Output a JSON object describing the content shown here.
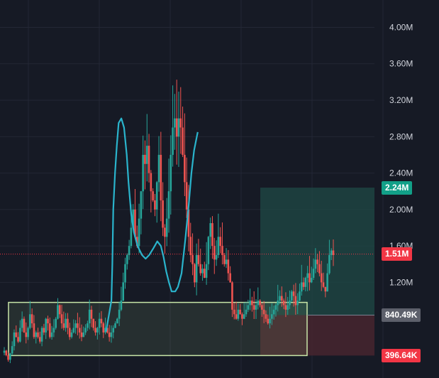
{
  "colors": {
    "background": "#161a25",
    "grid": "#232735",
    "up": "#26a69a",
    "down": "#ef5350",
    "curve": "#2ab4cc",
    "target_zone": "#1f4a46",
    "stop_zone": "#4a2630",
    "accumulation_box": "#c8e6a8",
    "tag_target": "#12a088",
    "tag_current": "#f23645",
    "tag_entry": "#5d606b",
    "tag_stop": "#f23645"
  },
  "price_tags": {
    "target": "2.24M",
    "current": "1.51M",
    "entry": "840.49K",
    "stop": "396.64K"
  },
  "chart_data": {
    "type": "candlestick",
    "y_axis": {
      "ticks": [
        "4.00M",
        "3.60M",
        "3.20M",
        "2.80M",
        "2.40M",
        "2.00M",
        "1.60M",
        "1.20M"
      ],
      "tick_values": [
        4.0,
        3.6,
        3.2,
        2.8,
        2.4,
        2.0,
        1.6,
        1.2
      ],
      "unit": "M",
      "range": [
        0.15,
        4.3
      ]
    },
    "levels": {
      "target": 2.24,
      "current": 1.51,
      "entry": 0.8405,
      "stop": 0.3966,
      "accumulation_top": 0.98
    },
    "close": [
      0.45,
      0.4,
      0.35,
      0.42,
      0.5,
      0.65,
      0.6,
      0.55,
      0.7,
      0.8,
      0.65,
      0.6,
      0.7,
      0.85,
      0.75,
      0.6,
      0.65,
      0.6,
      0.55,
      0.7,
      0.65,
      0.8,
      0.75,
      0.6,
      0.65,
      0.7,
      0.8,
      0.95,
      0.85,
      0.75,
      0.7,
      0.8,
      0.7,
      0.6,
      0.65,
      0.7,
      0.75,
      0.7,
      0.65,
      0.6,
      0.65,
      0.7,
      0.75,
      0.9,
      0.8,
      0.7,
      0.65,
      0.7,
      0.8,
      0.75,
      0.65,
      0.7,
      0.65,
      0.6,
      0.65,
      0.7,
      0.75,
      0.8,
      0.9,
      1.0,
      1.2,
      1.4,
      1.5,
      1.6,
      1.8,
      2.0,
      1.7,
      1.6,
      1.9,
      2.2,
      2.6,
      2.5,
      2.7,
      2.4,
      2.2,
      2.1,
      2.0,
      2.3,
      2.6,
      2.1,
      1.8,
      1.7,
      1.9,
      2.2,
      2.6,
      2.9,
      3.0,
      2.8,
      3.0,
      2.9,
      2.6,
      2.3,
      2.0,
      1.7,
      1.5,
      1.4,
      1.2,
      1.5,
      1.4,
      1.3,
      1.35,
      1.25,
      1.4,
      1.7,
      1.85,
      1.6,
      1.45,
      1.5,
      1.7,
      1.6,
      1.5,
      1.4,
      1.45,
      1.3,
      1.2,
      0.9,
      0.85,
      0.8,
      0.9,
      0.85,
      0.8,
      0.85,
      0.9,
      0.95,
      1.0,
      0.95,
      0.9,
      0.95,
      1.0,
      0.95,
      0.9,
      0.85,
      0.8,
      0.75,
      0.8,
      0.85,
      0.9,
      0.95,
      1.0,
      1.05,
      1.0,
      0.95,
      0.9,
      0.95,
      1.0,
      1.1,
      1.05,
      0.95,
      1.0,
      1.1,
      1.2,
      1.15,
      1.25,
      1.3,
      1.2,
      1.25,
      1.35,
      1.45,
      1.4,
      1.3,
      1.2,
      1.15,
      1.1,
      1.3,
      1.5,
      1.55,
      1.5
    ],
    "curve": [
      [
        0.59,
        0.66
      ],
      [
        0.62,
        1.0
      ],
      [
        0.625,
        1.4
      ],
      [
        0.63,
        2.0
      ],
      [
        0.64,
        2.4
      ],
      [
        0.65,
        2.7
      ],
      [
        0.66,
        2.95
      ],
      [
        0.675,
        3.0
      ],
      [
        0.69,
        2.9
      ],
      [
        0.705,
        2.6
      ],
      [
        0.715,
        2.3
      ],
      [
        0.73,
        1.95
      ],
      [
        0.745,
        1.75
      ],
      [
        0.765,
        1.6
      ],
      [
        0.79,
        1.5
      ],
      [
        0.81,
        1.46
      ],
      [
        0.83,
        1.5
      ],
      [
        0.855,
        1.58
      ],
      [
        0.875,
        1.65
      ],
      [
        0.895,
        1.6
      ],
      [
        0.91,
        1.48
      ],
      [
        0.925,
        1.32
      ],
      [
        0.94,
        1.2
      ],
      [
        0.955,
        1.1
      ],
      [
        0.975,
        1.1
      ],
      [
        0.99,
        1.15
      ],
      [
        1.01,
        1.3
      ],
      [
        1.03,
        1.65
      ],
      [
        1.05,
        2.05
      ],
      [
        1.065,
        2.4
      ],
      [
        1.08,
        2.65
      ],
      [
        1.1,
        2.85
      ]
    ]
  }
}
